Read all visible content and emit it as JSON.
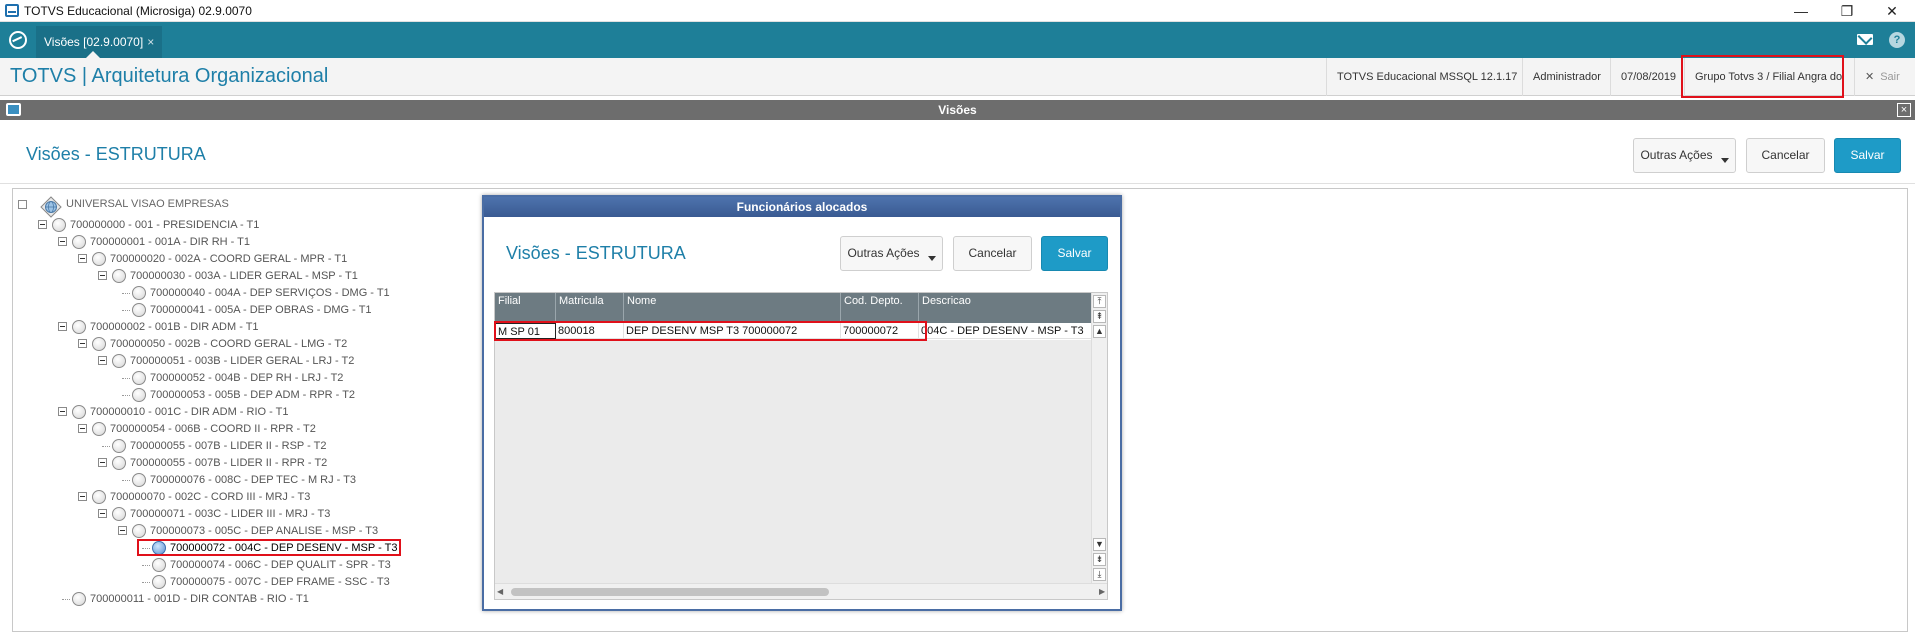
{
  "os_window": {
    "title": "TOTVS Educacional (Microsiga) 02.9.0070",
    "min_glyph": "—",
    "max_glyph": "❐",
    "close_glyph": "✕"
  },
  "tabbar": {
    "tab_label": "Visões [02.9.0070]",
    "tab_close": "×"
  },
  "header": {
    "app_title": "TOTVS | Arquitetura Organizacional",
    "environment": "TOTVS Educacional MSSQL 12.1.17",
    "user": "Administrador",
    "date": "07/08/2019",
    "company": "Grupo Totvs 3 / Filial Angra do",
    "exit_label": "Sair",
    "exit_icon": "✕"
  },
  "window": {
    "title": "Visões",
    "close": "×"
  },
  "page": {
    "title": "Visões - ESTRUTURA",
    "other_actions": "Outras Ações",
    "cancel": "Cancelar",
    "save": "Salvar"
  },
  "tree": {
    "root": "UNIVERSAL VISAO EMPRESAS",
    "nodes": [
      {
        "label": "700000000 - 001 - PRESIDENCIA - T1",
        "level": 1,
        "expander": true
      },
      {
        "label": "700000001 - 001A - DIR RH - T1",
        "level": 2,
        "expander": true
      },
      {
        "label": "700000020 - 002A - COORD GERAL - MPR - T1",
        "level": 3,
        "expander": true
      },
      {
        "label": "700000030 - 003A - LIDER GERAL - MSP - T1",
        "level": 4,
        "expander": true
      },
      {
        "label": "700000040 - 004A - DEP SERVIÇOS - DMG - T1",
        "level": 5,
        "expander": false
      },
      {
        "label": "700000041 - 005A - DEP OBRAS - DMG - T1",
        "level": 5,
        "expander": false
      },
      {
        "label": "700000002 - 001B - DIR ADM -  T1",
        "level": 2,
        "expander": true
      },
      {
        "label": "700000050 - 002B - COORD GERAL - LMG - T2",
        "level": 3,
        "expander": true
      },
      {
        "label": "700000051 - 003B - LIDER GERAL - LRJ - T2",
        "level": 4,
        "expander": true
      },
      {
        "label": "700000052 - 004B - DEP RH - LRJ - T2",
        "level": 5,
        "expander": false
      },
      {
        "label": "700000053 - 005B - DEP ADM - RPR - T2",
        "level": 5,
        "expander": false
      },
      {
        "label": "700000010 - 001C - DIR ADM - RIO - T1",
        "level": 2,
        "expander": true
      },
      {
        "label": "700000054 - 006B - COORD II - RPR - T2",
        "level": 3,
        "expander": true
      },
      {
        "label": "700000055 - 007B - LIDER II - RSP - T2",
        "level": 4,
        "expander": false
      },
      {
        "label": "700000055 - 007B - LIDER II - RPR - T2",
        "level": 4,
        "expander": true
      },
      {
        "label": "700000076 - 008C - DEP TEC - M RJ - T3",
        "level": 5,
        "expander": false
      },
      {
        "label": "700000070 - 002C - CORD III - MRJ - T3",
        "level": 3,
        "expander": true
      },
      {
        "label": "700000071 - 003C - LIDER III - MRJ - T3",
        "level": 4,
        "expander": true
      },
      {
        "label": "700000073 - 005C - DEP ANALISE - MSP - T3",
        "level": 5,
        "expander": true
      },
      {
        "label": "700000072 - 004C - DEP DESENV - MSP - T3",
        "level": 6,
        "expander": false,
        "selected": true
      },
      {
        "label": "700000074 - 006C - DEP QUALIT - SPR - T3",
        "level": 6,
        "expander": false
      },
      {
        "label": "700000075 - 007C - DEP FRAME - SSC - T3",
        "level": 6,
        "expander": false
      },
      {
        "label": "700000011 - 001D - DIR CONTAB - RIO - T1",
        "level": 2,
        "expander": false
      }
    ]
  },
  "dialog": {
    "title": "Funcionários alocados",
    "page_title": "Visões - ESTRUTURA",
    "other_actions": "Outras Ações",
    "cancel": "Cancelar",
    "save": "Salvar",
    "columns": [
      "Filial",
      "Matricula",
      "Nome",
      "Cod. Depto.",
      "Descricao"
    ],
    "rows": [
      [
        "M SP 01",
        "800018",
        "DEP DESENV MSP T3 700000072",
        "700000072",
        "004C - DEP DESENV - MSP - T3"
      ]
    ]
  },
  "colors": {
    "brand_teal": "#1e7f98",
    "title_blue": "#1e7fa8",
    "primary_button": "#1e9bc7",
    "highlight_red": "#e0101a",
    "dialog_header": "#4e73ad"
  }
}
